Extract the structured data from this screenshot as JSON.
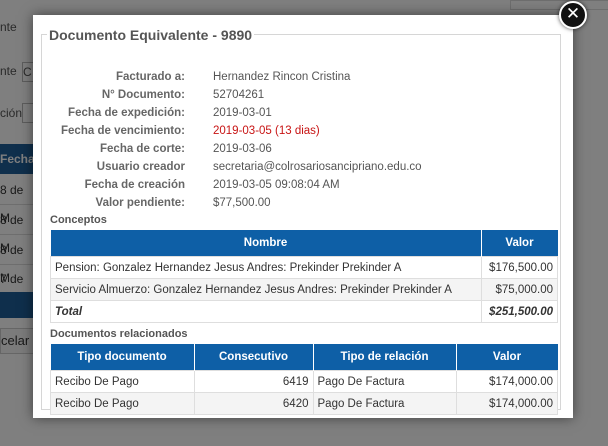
{
  "background": {
    "labels": [
      "nte",
      "nte",
      "ción"
    ],
    "field_value": "C",
    "table_header": "Fecha",
    "rows": [
      "8 de M",
      "8 de M",
      "8 de M",
      "7 de M"
    ],
    "button": "celar"
  },
  "modal": {
    "close_glyph": "✕",
    "title": "Documento Equivalente - 9890",
    "info": [
      {
        "label": "Facturado a:",
        "value": "Hernandez Rincon Cristina"
      },
      {
        "label": "N° Documento:",
        "value": "52704261"
      },
      {
        "label": "Fecha de expedición:",
        "value": "2019-03-01"
      },
      {
        "label": "Fecha de vencimiento:",
        "value": "2019-03-05 (13 dias)"
      },
      {
        "label": "Fecha de corte:",
        "value": "2019-03-06"
      },
      {
        "label": "Usuario creador",
        "value": "secretaria@colrosariosancipriano.edu.co"
      },
      {
        "label": "Fecha de creación",
        "value": "2019-03-05 09:08:04 AM"
      },
      {
        "label": "Valor pendiente:",
        "value": "$77,500.00"
      }
    ],
    "conceptos": {
      "title": "Conceptos",
      "headers": [
        "Nombre",
        "Valor"
      ],
      "rows": [
        {
          "nombre": "Pension: Gonzalez Hernandez Jesus Andres: Prekinder Prekinder A",
          "valor": "$176,500.00"
        },
        {
          "nombre": "Servicio Almuerzo: Gonzalez Hernandez Jesus Andres: Prekinder Prekinder A",
          "valor": "$75,000.00"
        }
      ],
      "total_label": "Total",
      "total_value": "$251,500.00"
    },
    "documentos": {
      "title": "Documentos relacionados",
      "headers": [
        "Tipo documento",
        "Consecutivo",
        "Tipo de relación",
        "Valor"
      ],
      "rows": [
        {
          "tipo": "Recibo De Pago",
          "consecutivo": "6419",
          "relacion": "Pago De Factura",
          "valor": "$174,000.00"
        },
        {
          "tipo": "Recibo De Pago",
          "consecutivo": "6420",
          "relacion": "Pago De Factura",
          "valor": "$174,000.00"
        }
      ]
    }
  },
  "colors": {
    "table_header": "#0e5fa6",
    "overdue_text": "#c81414",
    "overlay": "#000000"
  }
}
